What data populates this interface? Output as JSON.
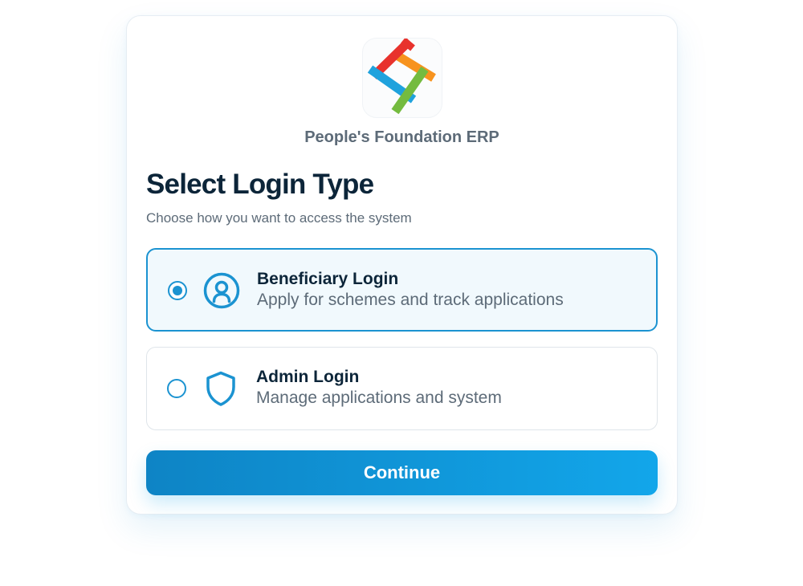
{
  "brand": {
    "name": "People's Foundation ERP",
    "logo_icon": "pinwheel-logo-icon"
  },
  "heading": {
    "title": "Select Login Type",
    "subtitle": "Choose how you want to access the system"
  },
  "options": [
    {
      "title": "Beneficiary Login",
      "description": "Apply for schemes and track applications",
      "icon": "user-circle-icon",
      "selected": true
    },
    {
      "title": "Admin Login",
      "description": "Manage applications and system",
      "icon": "shield-icon",
      "selected": false
    }
  ],
  "actions": {
    "continue_label": "Continue"
  },
  "colors": {
    "accent": "#1b93d1",
    "title": "#0c2539",
    "muted": "#5d6b78",
    "button_start": "#0e84c5",
    "button_end": "#12a6ea"
  }
}
